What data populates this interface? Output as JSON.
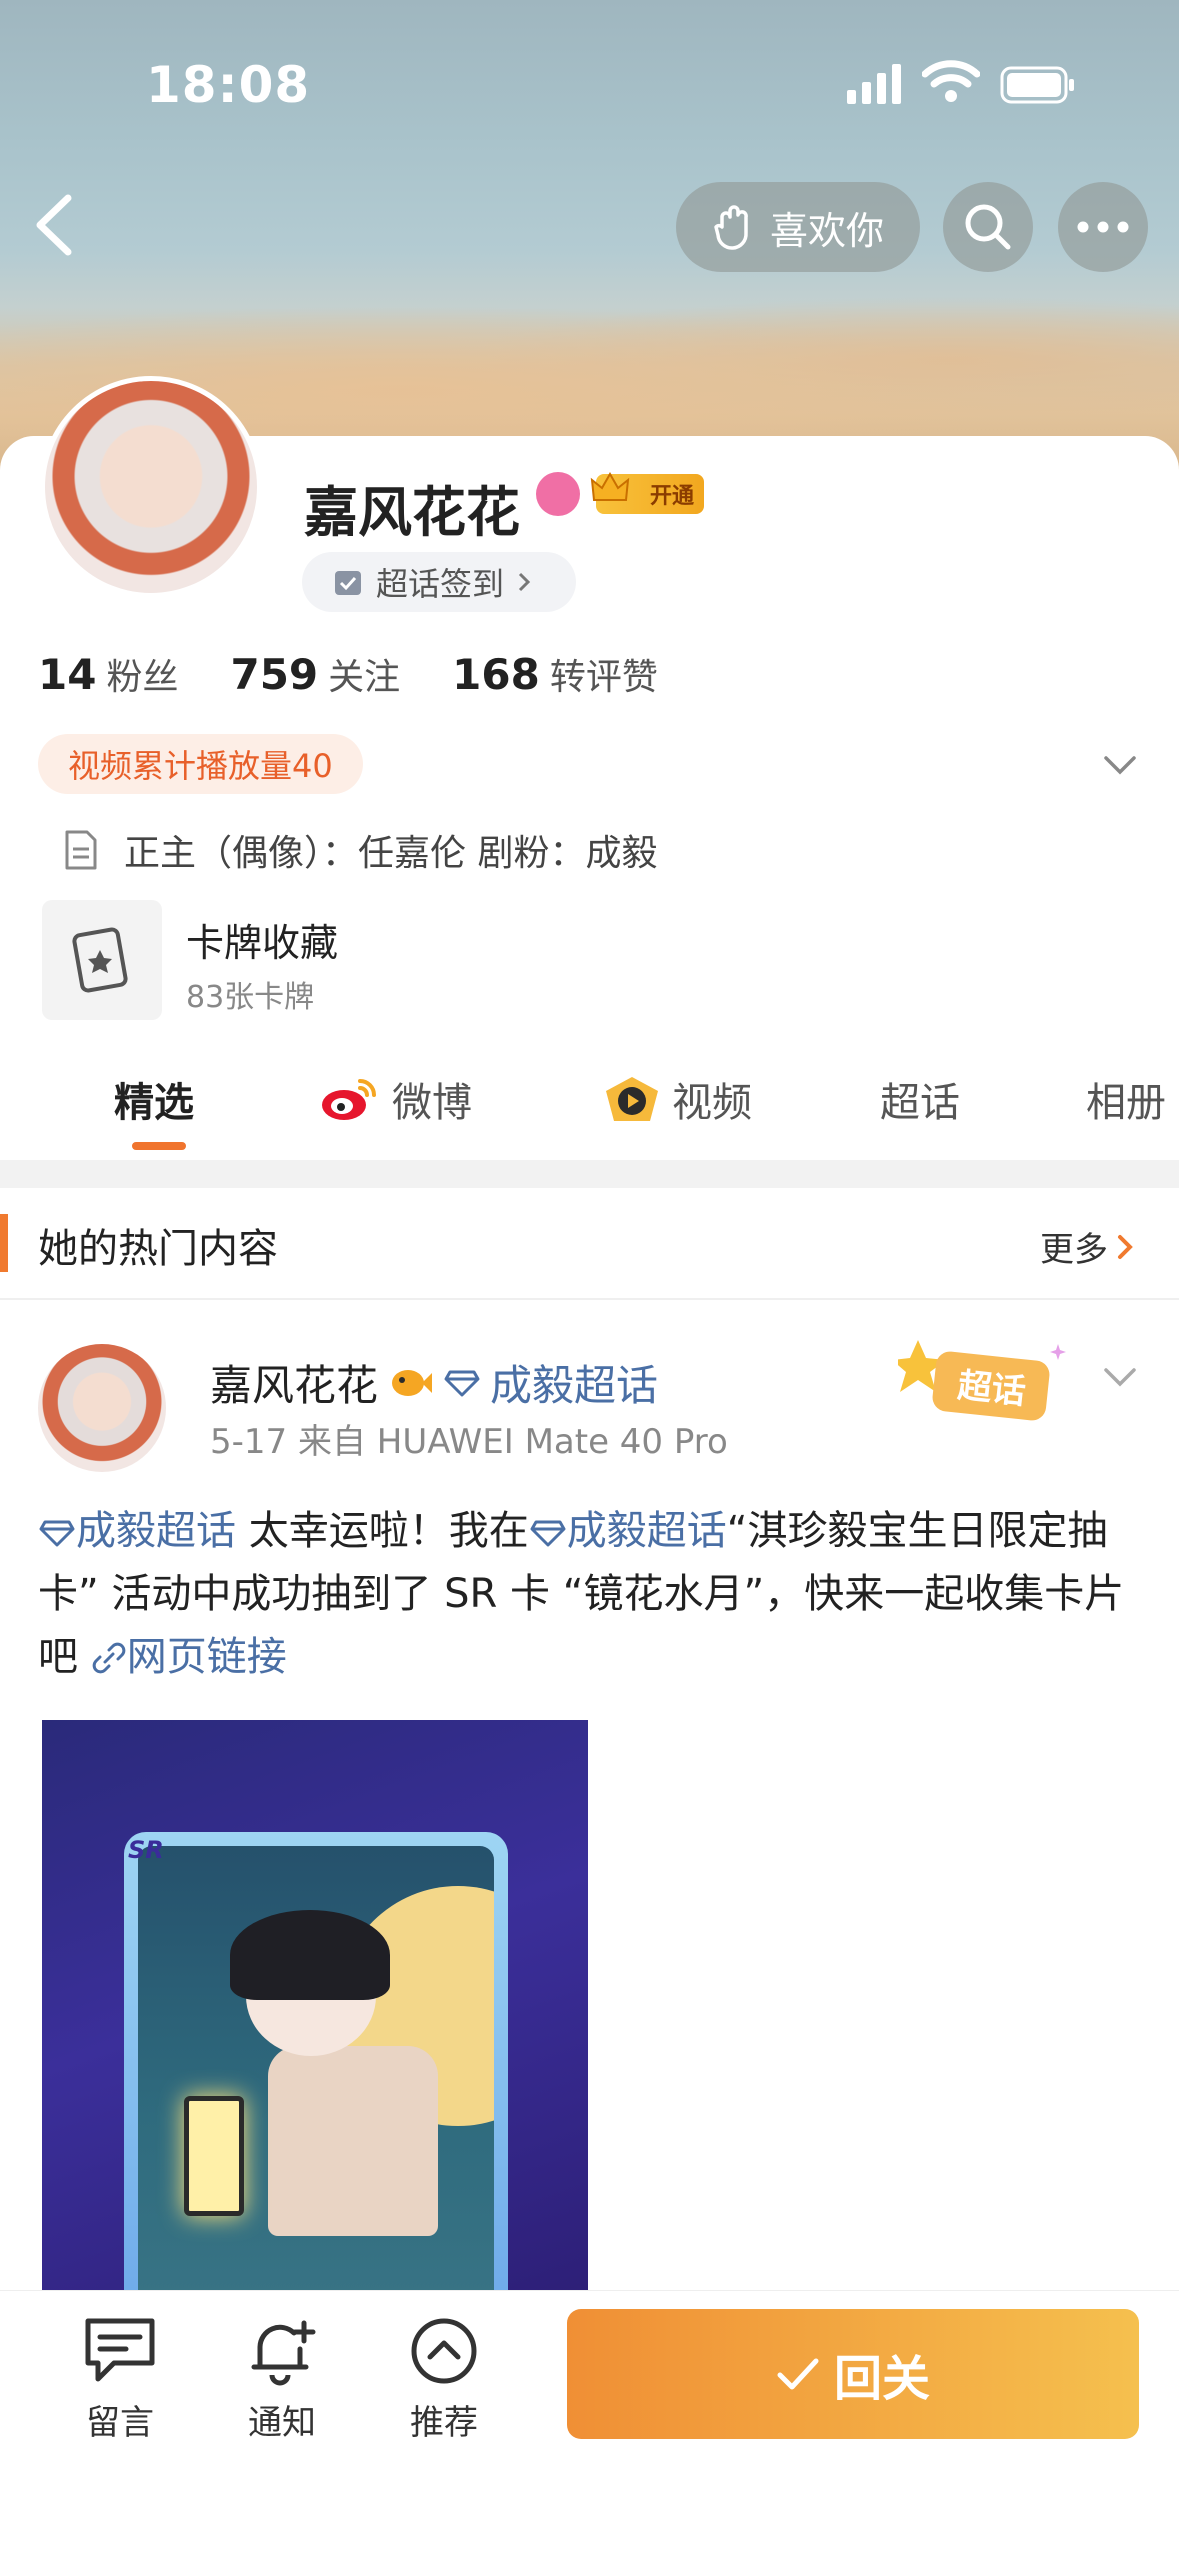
{
  "status_bar": {
    "time": "18:08"
  },
  "header": {
    "like_label": "喜欢你",
    "icons": [
      "back-icon",
      "hand-icon",
      "search-icon",
      "more-icon"
    ]
  },
  "profile": {
    "name": "嘉风花花",
    "vip_badge": "开通",
    "checkin_label": "超话签到",
    "stats": [
      {
        "value": "14",
        "label": "粉丝"
      },
      {
        "value": "759",
        "label": "关注"
      },
      {
        "value": "168",
        "label": "转评赞"
      }
    ],
    "video_plays": "视频累计播放量40",
    "bio": "正主（偶像）：任嘉伦 剧粉：成毅",
    "card_collection": {
      "title": "卡牌收藏",
      "count": "83张卡牌"
    }
  },
  "tabs": [
    "精选",
    "微博",
    "视频",
    "超话",
    "相册"
  ],
  "hot_section": {
    "title": "她的热门内容",
    "more": "更多"
  },
  "post": {
    "author": "嘉风花花",
    "topic": "成毅超话",
    "meta": "5-17  来自 HUAWEI Mate 40 Pro",
    "stamp": "超话",
    "text_parts": {
      "topic1": "成毅超话",
      "t1": " 太幸运啦！我在",
      "topic2": "成毅超话",
      "t2": "“淇珍毅宝生日限定抽卡” 活动中成功抽到了 SR 卡 “镜花水月”，快来一起收集卡片吧 ",
      "link": "网页链接"
    },
    "image": {
      "tag": "SR"
    }
  },
  "bottom_bar": {
    "items": [
      "留言",
      "通知",
      "推荐"
    ],
    "follow": "回关"
  },
  "colors": {
    "accent": "#f07a2f",
    "link": "#4a6fa5",
    "follow_start": "#f08f35",
    "follow_end": "#f5c04e"
  }
}
